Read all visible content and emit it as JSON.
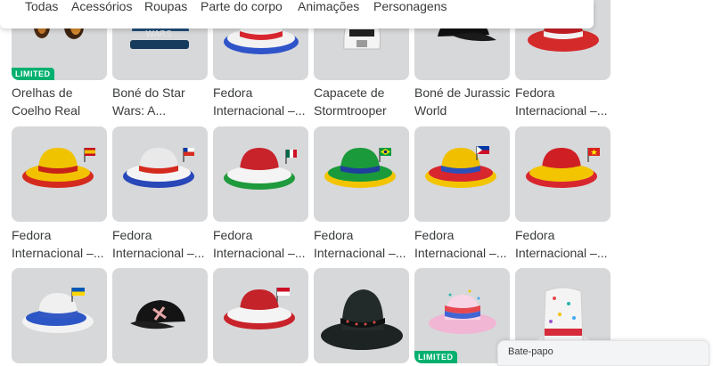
{
  "tabs": [
    "Todas",
    "Acessórios",
    "Roupas",
    "Parte do corpo",
    "Animações",
    "Personagens"
  ],
  "limited_label": "LIMITED",
  "chat_label": "Bate-papo",
  "items": [
    {
      "line1": "Orelhas de",
      "line2": "Coelho Real",
      "limited": true,
      "icon": "bunny-ears"
    },
    {
      "line1": "Boné do Star",
      "line2": "Wars: A...",
      "limited": false,
      "icon": "star-wars-cap"
    },
    {
      "line1": "Fedora",
      "line2": "Internacional –...",
      "limited": false,
      "icon": "fedora-red-white-blue"
    },
    {
      "line1": "Capacete de",
      "line2": "Stormtrooper",
      "limited": false,
      "icon": "stormtrooper-helmet"
    },
    {
      "line1": "Boné de Jurassic",
      "line2": "World",
      "limited": false,
      "icon": "jurassic-cap"
    },
    {
      "line1": "Fedora",
      "line2": "Internacional –...",
      "limited": false,
      "icon": "fedora-red-white"
    },
    {
      "line1": "Fedora",
      "line2": "Internacional –...",
      "limited": false,
      "icon": "fedora-spain"
    },
    {
      "line1": "Fedora",
      "line2": "Internacional –...",
      "limited": false,
      "icon": "fedora-chile"
    },
    {
      "line1": "Fedora",
      "line2": "Internacional –...",
      "limited": false,
      "icon": "fedora-mexico"
    },
    {
      "line1": "Fedora",
      "line2": "Internacional –...",
      "limited": false,
      "icon": "fedora-brazil"
    },
    {
      "line1": "Fedora",
      "line2": "Internacional –...",
      "limited": false,
      "icon": "fedora-philippines"
    },
    {
      "line1": "Fedora",
      "line2": "Internacional –...",
      "limited": false,
      "icon": "fedora-vietnam"
    },
    {
      "line1": "",
      "line2": "",
      "limited": false,
      "icon": "fedora-ukraine"
    },
    {
      "line1": "",
      "line2": "",
      "limited": false,
      "icon": "black-cap"
    },
    {
      "line1": "",
      "line2": "",
      "limited": false,
      "icon": "fedora-red-white-striped"
    },
    {
      "line1": "",
      "line2": "",
      "limited": false,
      "icon": "black-studded-hat"
    },
    {
      "line1": "",
      "line2": "",
      "limited": true,
      "icon": "party-fedora"
    },
    {
      "line1": "",
      "line2": "",
      "limited": false,
      "icon": "confetti-top-hat"
    }
  ],
  "colors": {
    "tile": "#d7d8da",
    "text": "#393b3d",
    "limited_green": "#00b06f"
  }
}
